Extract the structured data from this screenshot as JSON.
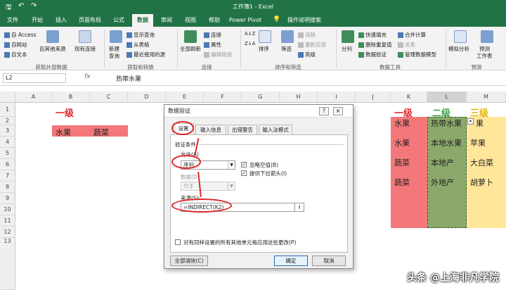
{
  "titlebar": {
    "title": "工作簿1 - Excel",
    "quick_save": "🖫",
    "quick_undo": "↶",
    "quick_redo": "↷"
  },
  "tabs": [
    "文件",
    "开始",
    "插入",
    "页面布局",
    "公式",
    "数据",
    "审阅",
    "视图",
    "帮助",
    "Power Pivot",
    "操作说明搜索"
  ],
  "active_tab": "数据",
  "ribbon": {
    "get_external": {
      "access": "自 Access",
      "web": "自网站",
      "text": "自文本",
      "other": "自其他来源",
      "existing": "现有连接",
      "group": "获取外部数据"
    },
    "transform": {
      "new_query": "新建\n查询",
      "show_queries": "显示查询",
      "from_table": "从表格",
      "recent": "最近使用的源",
      "group": "获取和转换"
    },
    "connections": {
      "refresh": "全部刷新",
      "connections": "连接",
      "properties": "属性",
      "edit_links": "编辑链接",
      "group": "连接"
    },
    "sort_filter": {
      "sort": "排序",
      "filter": "筛选",
      "clear": "清除",
      "reapply": "重新应用",
      "advanced": "高级",
      "group": "排序和筛选"
    },
    "data_tools": {
      "split": "分列",
      "flash_fill": "快速填充",
      "remove_dup": "删除重复值",
      "validation": "数据验证",
      "consolidate": "合并计算",
      "relations": "关系",
      "model": "管理数据模型",
      "group": "数据工具"
    },
    "forecast": {
      "whatif": "模拟分析",
      "sheet": "预测\n工作表",
      "group": "预测"
    }
  },
  "formula_bar": {
    "name_box": "L2",
    "fx": "fx",
    "value": "热带水果"
  },
  "columns": [
    "A",
    "B",
    "C",
    "D",
    "E",
    "F",
    "G",
    "H",
    "I",
    "J",
    "K",
    "L",
    "M"
  ],
  "rows": [
    "1",
    "2",
    "3",
    "4",
    "5",
    "6",
    "7",
    "8",
    "9",
    "10",
    "11",
    "12",
    "13"
  ],
  "cells": {
    "b1": "一级",
    "b3": "水果",
    "c3": "蔬菜",
    "k1": "一级",
    "l1": "二级",
    "m1": "三级",
    "k3": "水果",
    "k5": "水果",
    "k7": "蔬菜",
    "k9": "蔬菜",
    "l3": "热带水果",
    "l5": "本地水果",
    "l7": "本地产",
    "l9": "外地产",
    "m3": "果",
    "m5": "苹果",
    "m7": "大白菜",
    "m9": "胡萝卜"
  },
  "dialog": {
    "title": "数据验证",
    "help": "?",
    "close": "×",
    "tabs": [
      "设置",
      "输入信息",
      "出错警告",
      "输入法模式"
    ],
    "criteria_label": "验证条件",
    "allow_label": "允许(A)",
    "allow_value": "序列",
    "data_label": "数据(D)",
    "data_value": "介于",
    "ignore_blank": "忽略空值(B)",
    "dropdown": "提供下拉箭头(I)",
    "source_label": "来源(S):",
    "source_value": "=INDIRECT(K2)",
    "apply_all": "对有同样设置的所有其他单元格应用这些更改(P)",
    "clear_all": "全部清除(C)",
    "ok": "确定",
    "cancel": "取消"
  },
  "watermark": "头条 @上海非凡学院",
  "colors": {
    "excel_green": "#217346",
    "red_fill": "#f4777a",
    "green_fill": "#8aa96a",
    "yellow_fill": "#ffe699",
    "annot_red": "#e0272b"
  }
}
